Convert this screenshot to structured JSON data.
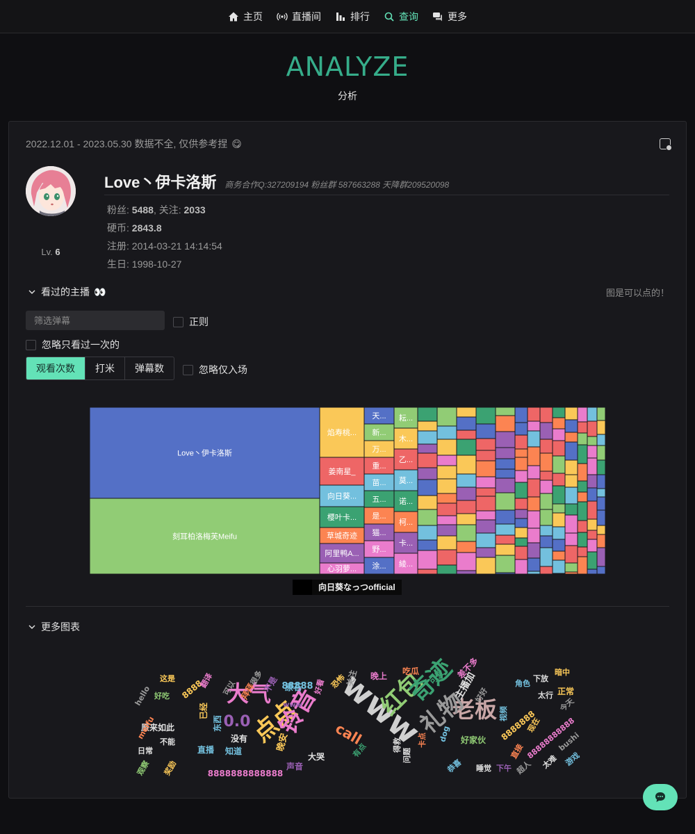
{
  "nav": {
    "items": [
      {
        "label": "主页",
        "icon": "home-icon",
        "active": false
      },
      {
        "label": "直播间",
        "icon": "broadcast-icon",
        "active": false
      },
      {
        "label": "排行",
        "icon": "rank-bars-icon",
        "active": false
      },
      {
        "label": "查询",
        "icon": "search-icon",
        "active": true
      },
      {
        "label": "更多",
        "icon": "chat-bubbles-icon",
        "active": false
      }
    ]
  },
  "hero": {
    "title": "ANALYZE",
    "subtitle": "分析"
  },
  "card": {
    "date_range": "2022.12.01 - 2023.05.30 数据不全, 仅供参考捏",
    "date_emoji": "😋",
    "profile": {
      "name": "Love丶伊卡洛斯",
      "info": "商务合作Q:327209194 粉丝群 587663288 天降群209520098",
      "level_label": "Lv.",
      "level": "6",
      "fans_label": "粉丝:",
      "fans": "5488",
      "follow_label": ", 关注:",
      "follow": "2033",
      "coins_label": "硬币:",
      "coins": "2843.8",
      "register_label": "注册:",
      "register": "2014-03-21 14:14:54",
      "birthday_label": "生日:",
      "birthday": "1998-10-27"
    },
    "watched_section": {
      "title": "看过的主播",
      "emoji": "👀",
      "hint": "图是可以点的！",
      "filter_placeholder": "筛选弹幕",
      "regex_label": "正则",
      "ignore_once_label": "忽略只看过一次的",
      "tabs": [
        "观看次数",
        "打米",
        "弹幕数"
      ],
      "active_tab": 0,
      "ignore_enter_label": "忽略仅入场"
    },
    "treemap": {
      "tooltip": "向日葵なっつofficial",
      "palette": [
        "#5470c6",
        "#91cc75",
        "#fac858",
        "#ee6666",
        "#73c0de",
        "#3ba272",
        "#fc8452",
        "#9a60b4",
        "#ea7ccc"
      ],
      "nodes": [
        {
          "label": "Love丶伊卡洛斯",
          "color": "#5470c6"
        },
        {
          "label": "刻耳柏洛梅芙Meifu",
          "color": "#91cc75"
        }
      ],
      "column_a": [
        {
          "label": "焰寿桃...",
          "color": "#fac858"
        },
        {
          "label": "姜南星_",
          "color": "#ee6666"
        },
        {
          "label": "向日葵...",
          "color": "#73c0de"
        },
        {
          "label": "樱叶卡...",
          "color": "#3ba272"
        },
        {
          "label": "草城奇迹",
          "color": "#fc8452"
        },
        {
          "label": "阿里鸭A...",
          "color": "#9a60b4"
        },
        {
          "label": "心羽萝...",
          "color": "#ea7ccc"
        }
      ],
      "column_b": [
        {
          "label": "天...",
          "color": "#5470c6"
        },
        {
          "label": "新...",
          "color": "#91cc75"
        },
        {
          "label": "万...",
          "color": "#fac858"
        },
        {
          "label": "重...",
          "color": "#ee6666"
        },
        {
          "label": "苗...",
          "color": "#73c0de"
        },
        {
          "label": "五...",
          "color": "#3ba272"
        },
        {
          "label": "是...",
          "color": "#fc8452"
        },
        {
          "label": "猫...",
          "color": "#9a60b4"
        },
        {
          "label": "野...",
          "color": "#ea7ccc"
        },
        {
          "label": "涂...",
          "color": "#5470c6"
        }
      ],
      "column_c": [
        {
          "label": "耘...",
          "color": "#91cc75"
        },
        {
          "label": "木...",
          "color": "#fac858"
        },
        {
          "label": "乙...",
          "color": "#ee6666"
        },
        {
          "label": "莫...",
          "color": "#73c0de"
        },
        {
          "label": "诺...",
          "color": "#3ba272"
        },
        {
          "label": "柯...",
          "color": "#fc8452"
        },
        {
          "label": "卡...",
          "color": "#9a60b4"
        },
        {
          "label": "綾...",
          "color": "#ea7ccc"
        }
      ]
    },
    "more_section": {
      "title": "更多图表"
    },
    "wordcloud": {
      "colors": [
        "#5470c6",
        "#91cc75",
        "#fac858",
        "#ee6666",
        "#73c0de",
        "#3ba272",
        "#fc8452",
        "#9a60b4",
        "#ea7ccc",
        "#c0c0c0"
      ],
      "words": [
        {
          "text": "老板",
          "weight": 5,
          "color": "#c9a7a7"
        },
        {
          "text": "www",
          "weight": 6,
          "color": "#d0d0d0"
        },
        {
          "text": "红包",
          "weight": 5,
          "color": "#91cc75"
        },
        {
          "text": "奇迹",
          "weight": 5,
          "color": "#3ba272"
        },
        {
          "text": "礼物",
          "weight": 5,
          "color": "#9a9a9a"
        },
        {
          "text": "大气",
          "weight": 5,
          "color": "#ea7ccc"
        },
        {
          "text": "点点",
          "weight": 5,
          "color": "#fac858"
        },
        {
          "text": "铃音",
          "weight": 5,
          "color": "#ea7ccc"
        },
        {
          "text": "0.0",
          "weight": 4,
          "color": "#9a60b4"
        },
        {
          "text": "call",
          "weight": 4,
          "color": "#fc8452"
        },
        {
          "text": "主播加",
          "weight": 3,
          "color": "#e0e0e0"
        },
        {
          "text": "88888",
          "weight": 2,
          "color": "#73c0de"
        },
        {
          "text": "8888",
          "weight": 2,
          "color": "#fac858"
        },
        {
          "text": "8888888",
          "weight": 2,
          "color": "#fac858"
        },
        {
          "text": "88888888888",
          "weight": 2,
          "color": "#ea7ccc"
        },
        {
          "text": "8888888888888",
          "weight": 2,
          "color": "#ea7ccc"
        },
        {
          "text": "好家伙",
          "weight": 2,
          "color": "#91cc75"
        },
        {
          "text": "原来如此",
          "weight": 2,
          "color": "#e0e0e0"
        },
        {
          "text": "晚安",
          "weight": 2,
          "color": "#fac858"
        },
        {
          "text": "直播",
          "weight": 2,
          "color": "#73c0de"
        },
        {
          "text": "知道",
          "weight": 2,
          "color": "#73c0de"
        },
        {
          "text": "大哭",
          "weight": 2,
          "color": "#e0e0e0"
        },
        {
          "text": "声音",
          "weight": 2,
          "color": "#9a60b4"
        },
        {
          "text": "原石",
          "weight": 2,
          "color": "#73c0de"
        },
        {
          "text": "关注",
          "weight": 2,
          "color": "#9a9a9a"
        },
        {
          "text": "晚上",
          "weight": 2,
          "color": "#ea7ccc"
        },
        {
          "text": "吃瓜",
          "weight": 2,
          "color": "#fc8452"
        },
        {
          "text": "可爱",
          "weight": 2,
          "color": "#3ba272"
        },
        {
          "text": "差不多",
          "weight": 2,
          "color": "#ea7ccc"
        },
        {
          "text": "角色",
          "weight": 2,
          "color": "#73c0de"
        },
        {
          "text": "下放",
          "weight": 2,
          "color": "#e0e0e0"
        },
        {
          "text": "暗中",
          "weight": 2,
          "color": "#fac858"
        },
        {
          "text": "太行",
          "weight": 2,
          "color": "#e0e0e0"
        },
        {
          "text": "正常",
          "weight": 2,
          "color": "#fac858"
        },
        {
          "text": "今天",
          "weight": 2,
          "color": "#9a9a9a"
        },
        {
          "text": "bushi",
          "weight": 2,
          "color": "#9a9a9a"
        },
        {
          "text": "游戏",
          "weight": 2,
          "color": "#73c0de"
        },
        {
          "text": "太难",
          "weight": 2,
          "color": "#e0e0e0"
        },
        {
          "text": "超人",
          "weight": 2,
          "color": "#9a9a9a"
        },
        {
          "text": "下午",
          "weight": 2,
          "color": "#9a60b4"
        },
        {
          "text": "睡觉",
          "weight": 2,
          "color": "#e0e0e0"
        },
        {
          "text": "恭喜",
          "weight": 2,
          "color": "#73c0de"
        },
        {
          "text": "dog",
          "weight": 2,
          "color": "#73c0de"
        },
        {
          "text": "这是",
          "weight": 2,
          "color": "#fac858"
        },
        {
          "text": "好吃",
          "weight": 2,
          "color": "#91cc75"
        },
        {
          "text": "hello",
          "weight": 2,
          "color": "#9a9a9a"
        },
        {
          "text": "meifu",
          "weight": 2,
          "color": "#fc8452"
        },
        {
          "text": "不能",
          "weight": 2,
          "color": "#e0e0e0"
        },
        {
          "text": "日常",
          "weight": 2,
          "color": "#e0e0e0"
        },
        {
          "text": "观察",
          "weight": 2,
          "color": "#91cc75"
        },
        {
          "text": "奖励",
          "weight": 2,
          "color": "#fac858"
        },
        {
          "text": "没有",
          "weight": 2,
          "color": "#e0e0e0"
        },
        {
          "text": "拜拜",
          "weight": 2,
          "color": "#fc8452"
        },
        {
          "text": "不是",
          "weight": 2,
          "color": "#9a60b4"
        },
        {
          "text": "东西",
          "weight": 2,
          "color": "#73c0de"
        },
        {
          "text": "已经",
          "weight": 2,
          "color": "#fac858"
        },
        {
          "text": "直接",
          "weight": 2,
          "color": "#fc8452"
        },
        {
          "text": "视频",
          "weight": 2,
          "color": "#73c0de"
        },
        {
          "text": "现在",
          "weight": 2,
          "color": "#fac858"
        },
        {
          "text": "有点",
          "weight": 2,
          "color": "#3ba272"
        },
        {
          "text": "恐怖",
          "weight": 2,
          "color": "#fac858"
        },
        {
          "text": "好看",
          "weight": 2,
          "color": "#ea7ccc"
        },
        {
          "text": "得救",
          "weight": 2,
          "color": "#e0e0e0"
        },
        {
          "text": "卡点",
          "weight": 2,
          "color": "#fc8452"
        },
        {
          "text": "好好",
          "weight": 2,
          "color": "#9a9a9a"
        },
        {
          "text": "翻译",
          "weight": 2,
          "color": "#ea7ccc"
        },
        {
          "text": "很多",
          "weight": 2,
          "color": "#9a9a9a"
        },
        {
          "text": "问题",
          "weight": 2,
          "color": "#e0e0e0"
        },
        {
          "text": "www",
          "weight": 2,
          "color": "#9a60b4"
        },
        {
          "text": "可以",
          "weight": 2,
          "color": "#9a9a9a"
        }
      ]
    }
  }
}
